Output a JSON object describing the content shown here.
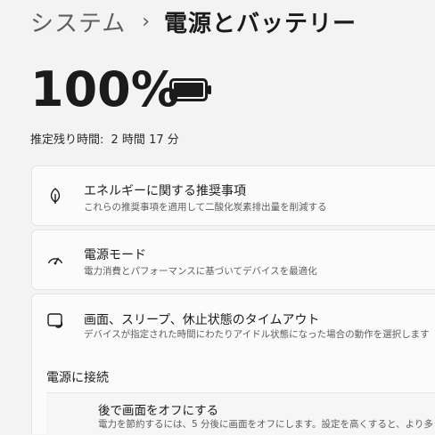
{
  "breadcrumb": {
    "parent": "システム",
    "separator": "›",
    "current": "電源とバッテリー"
  },
  "battery": {
    "percent": "100%",
    "level": 1.0,
    "remaining_label": "推定残り時間:",
    "remaining_value": "2 時間 17 分"
  },
  "cards": [
    {
      "icon": "leaf-icon",
      "title": "エネルギーに関する推奨事項",
      "description": "これらの推奨事項を適用して二酸化炭素排出量を削減する"
    },
    {
      "icon": "power-mode-icon",
      "title": "電源モード",
      "description": "電力消費とパフォーマンスに基づいてデバイスを最適化"
    },
    {
      "icon": "screen-sleep-icon",
      "title": "画面、スリープ、休止状態のタイムアウト",
      "description": "デバイスが指定された時間にわたりアイドル状態になった場合の動作を選択します"
    }
  ],
  "plugged_section": {
    "title": "電源に接続",
    "item": {
      "title": "後で画面をオフにする",
      "description": "電力を節約するには、5 分後に画面をオフにします。設定を高くすると、より多くの"
    }
  },
  "colors": {
    "background": "#f3f3f3",
    "card": "#fbfbfb",
    "text": "#1b1b1b",
    "secondary_text": "#5c5c5c"
  }
}
